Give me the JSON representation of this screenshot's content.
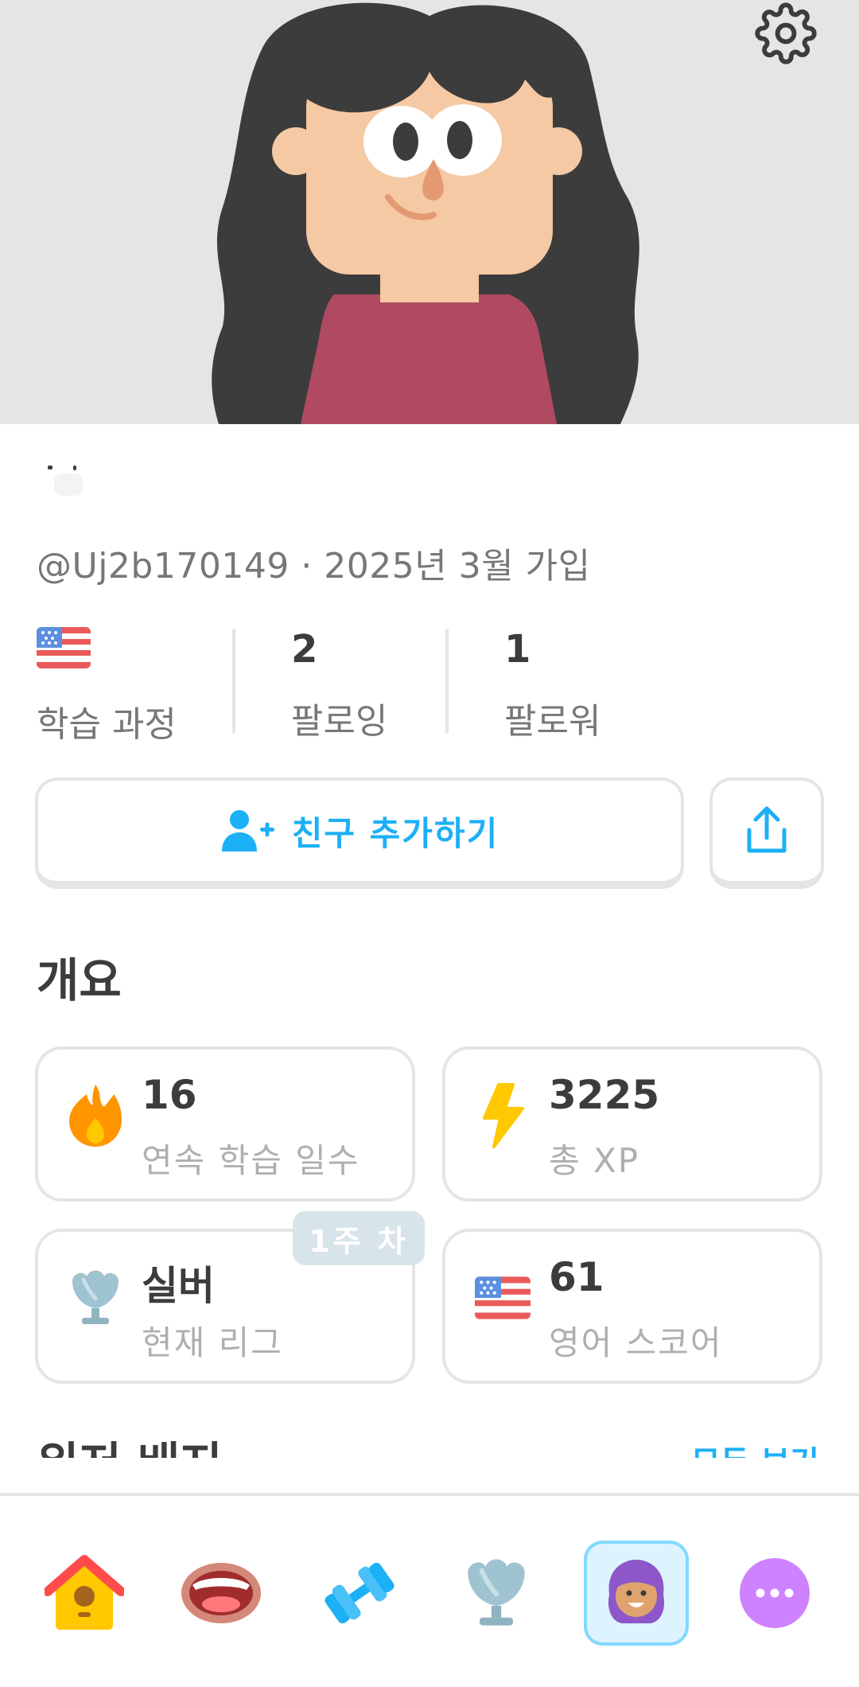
{
  "profile": {
    "handle_line": "@Uj2b170149 · 2025년 3월 가입",
    "stats": {
      "course_label": "학습 과정",
      "following_count": "2",
      "following_label": "팔로잉",
      "followers_count": "1",
      "followers_label": "팔로워"
    }
  },
  "actions": {
    "add_friend_label": "친구 추가하기"
  },
  "overview": {
    "title": "개요",
    "streak_value": "16",
    "streak_label": "연속 학습 일수",
    "xp_value": "3225",
    "xp_label": "총 XP",
    "league_value": "실버",
    "league_label": "현재 리그",
    "league_badge": "1주 차",
    "score_value": "61",
    "score_label": "영어 스코어"
  },
  "next_section": {
    "title_partial": "위저 배지",
    "link_partial": "모두 보기"
  },
  "icons": {
    "settings": "gear-icon",
    "flag": "us-flag-icon",
    "add_friend": "add-user-icon",
    "share": "share-icon",
    "streak": "fire-icon",
    "xp": "lightning-icon",
    "league": "silver-trophy-icon",
    "tabs": [
      "home-icon",
      "mouth-icon",
      "dumbbell-icon",
      "trophy-icon",
      "avatar-icon",
      "more-icon"
    ]
  },
  "colors": {
    "accent_blue": "#1cb0f6",
    "hero_bg": "#e5e5e5",
    "card_border": "#e5e5e5",
    "muted_text": "#afafaf",
    "more_purple": "#ce82ff"
  }
}
